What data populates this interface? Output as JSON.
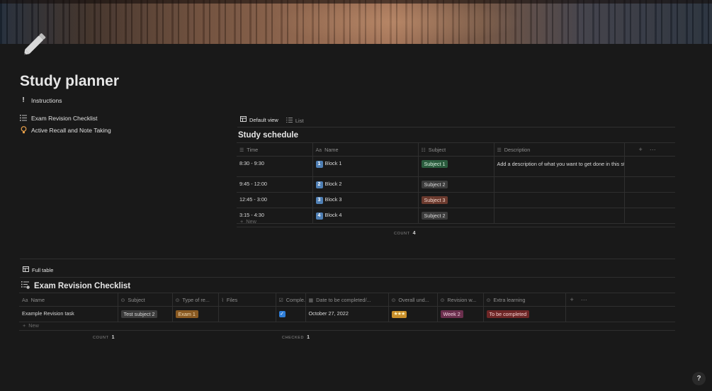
{
  "page": {
    "title": "Study planner",
    "links": [
      {
        "label": "Instructions",
        "icon": "exclamation-icon"
      },
      {
        "label": "Exam Revision Checklist",
        "icon": "checklist-icon"
      },
      {
        "label": "Active Recall and Note Taking",
        "icon": "lightbulb-icon"
      }
    ]
  },
  "schedule": {
    "tabs": [
      "Default view",
      "List"
    ],
    "title": "Study schedule",
    "columns": [
      "Time",
      "Name",
      "Subject",
      "Description"
    ],
    "rows": [
      {
        "time": "8:30 - 9:30",
        "num": "1",
        "name": "Block 1",
        "subject": "Subject 1",
        "subject_color": "#2b5c3e",
        "description": "Add a description of what you want to get done in this study block"
      },
      {
        "time": "9:45 - 12:00",
        "num": "2",
        "name": "Block 2",
        "subject": "Subject 2",
        "subject_color": "#3c3c3c",
        "description": ""
      },
      {
        "time": "12:45 - 3:00",
        "num": "3",
        "name": "Block 3",
        "subject": "Subject 3",
        "subject_color": "#6b3a2e",
        "description": ""
      },
      {
        "time": "3:15 - 4:30",
        "num": "4",
        "name": "Block 4",
        "subject": "Subject 2",
        "subject_color": "#3c3c3c",
        "description": ""
      }
    ],
    "new_label": "New",
    "count_label": "COUNT",
    "count_value": "4"
  },
  "checklist": {
    "tab": "Full table",
    "title": "Exam Revision Checklist",
    "columns": [
      "Name",
      "Subject",
      "Type of re...",
      "Files",
      "Comple...",
      "Date to be completed/...",
      "Overall und...",
      "Revision w...",
      "Extra learning"
    ],
    "row": {
      "name": "Example Revision task",
      "subject": "Test subject 2",
      "type": "Exam 1",
      "files": "",
      "completed": true,
      "date": "October 27, 2022",
      "understanding": "★★★",
      "week": "Week 2",
      "extra": "To be completed"
    },
    "new_label": "New",
    "count_label": "COUNT",
    "count_value": "1",
    "checked_label": "CHECKED",
    "checked_value": "1"
  },
  "colors": {
    "background": "#191919",
    "tag_gray": "#3c3c3c",
    "tag_green": "#2b5c3e",
    "tag_brown": "#6b3a2e",
    "tag_orange": "#8a5a22",
    "tag_pink": "#6a2f4d",
    "tag_red": "#6e2626",
    "checkbox_blue": "#2f7ed8"
  },
  "help": {
    "label": "?"
  }
}
